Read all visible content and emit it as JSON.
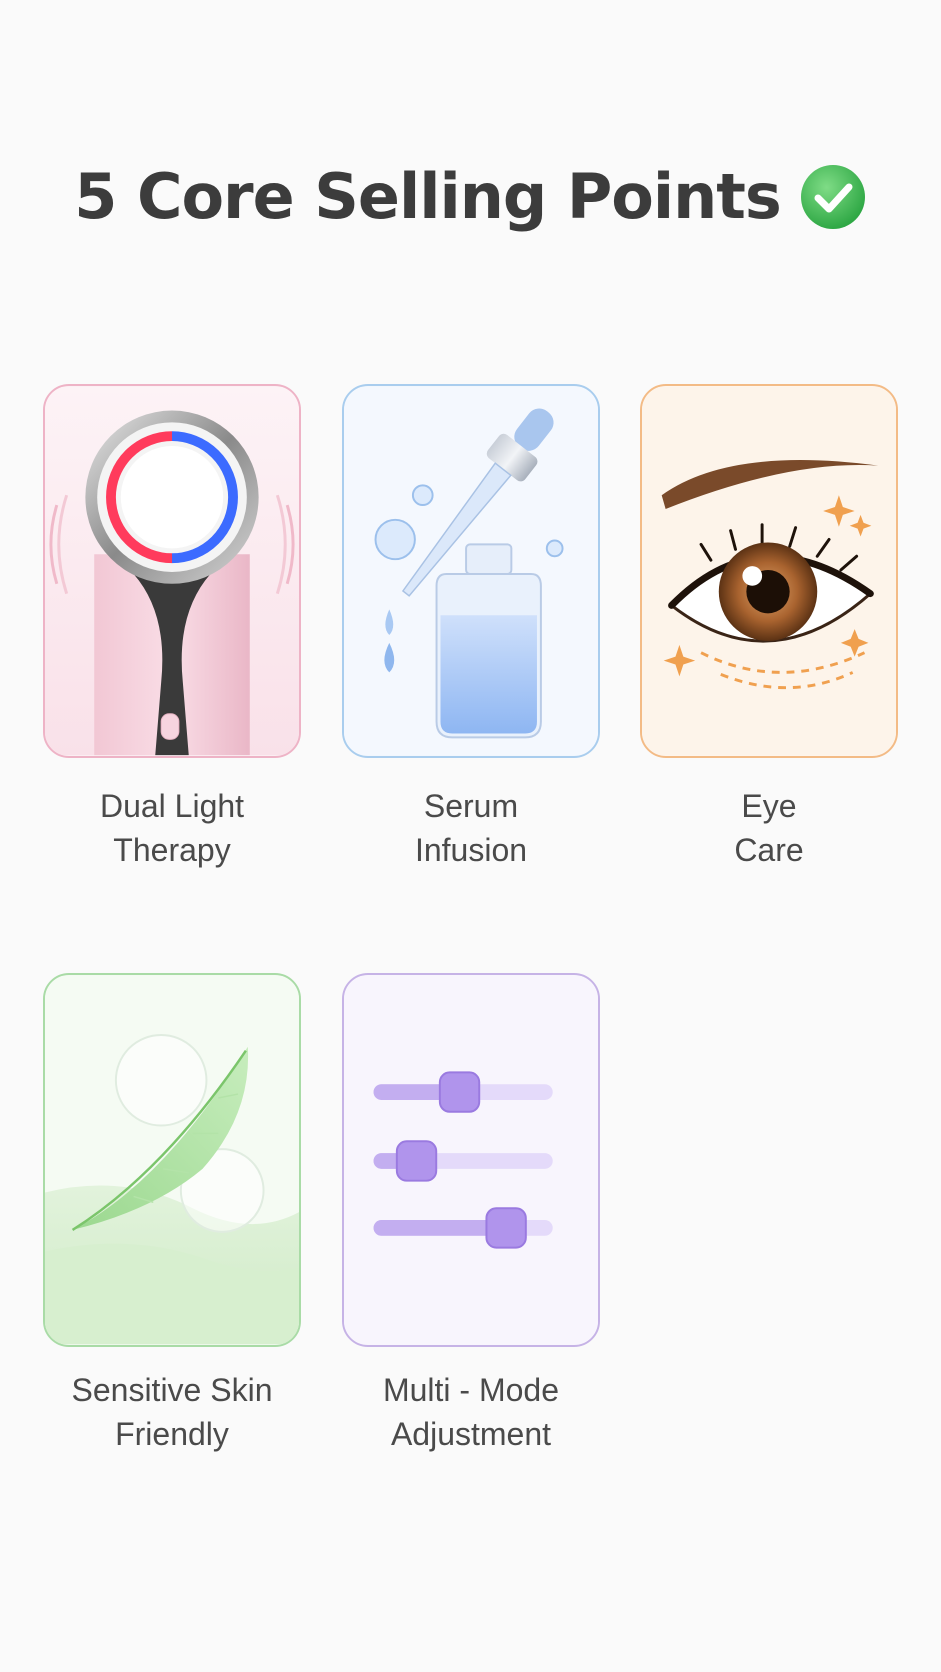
{
  "title": "5 Core Selling Points",
  "colors": {
    "accent_check": "#45c15a",
    "pink_border": "#eeb3c6",
    "blue_border": "#a9cdee",
    "orange_border": "#f3bb86",
    "green_border": "#a9dba6",
    "purple_border": "#c6b3e6"
  },
  "features": [
    {
      "icon": "light-therapy-device-icon",
      "line1": "Dual Light",
      "line2": "Therapy"
    },
    {
      "icon": "serum-dropper-icon",
      "line1": "Serum",
      "line2": "Infusion"
    },
    {
      "icon": "eye-icon",
      "line1": "Eye",
      "line2": "Care"
    },
    {
      "icon": "feather-icon",
      "line1": "Sensitive Skin",
      "line2": "Friendly"
    },
    {
      "icon": "sliders-icon",
      "line1": "Multi - Mode",
      "line2": "Adjustment"
    }
  ],
  "sliders": [
    0.48,
    0.24,
    0.74
  ]
}
